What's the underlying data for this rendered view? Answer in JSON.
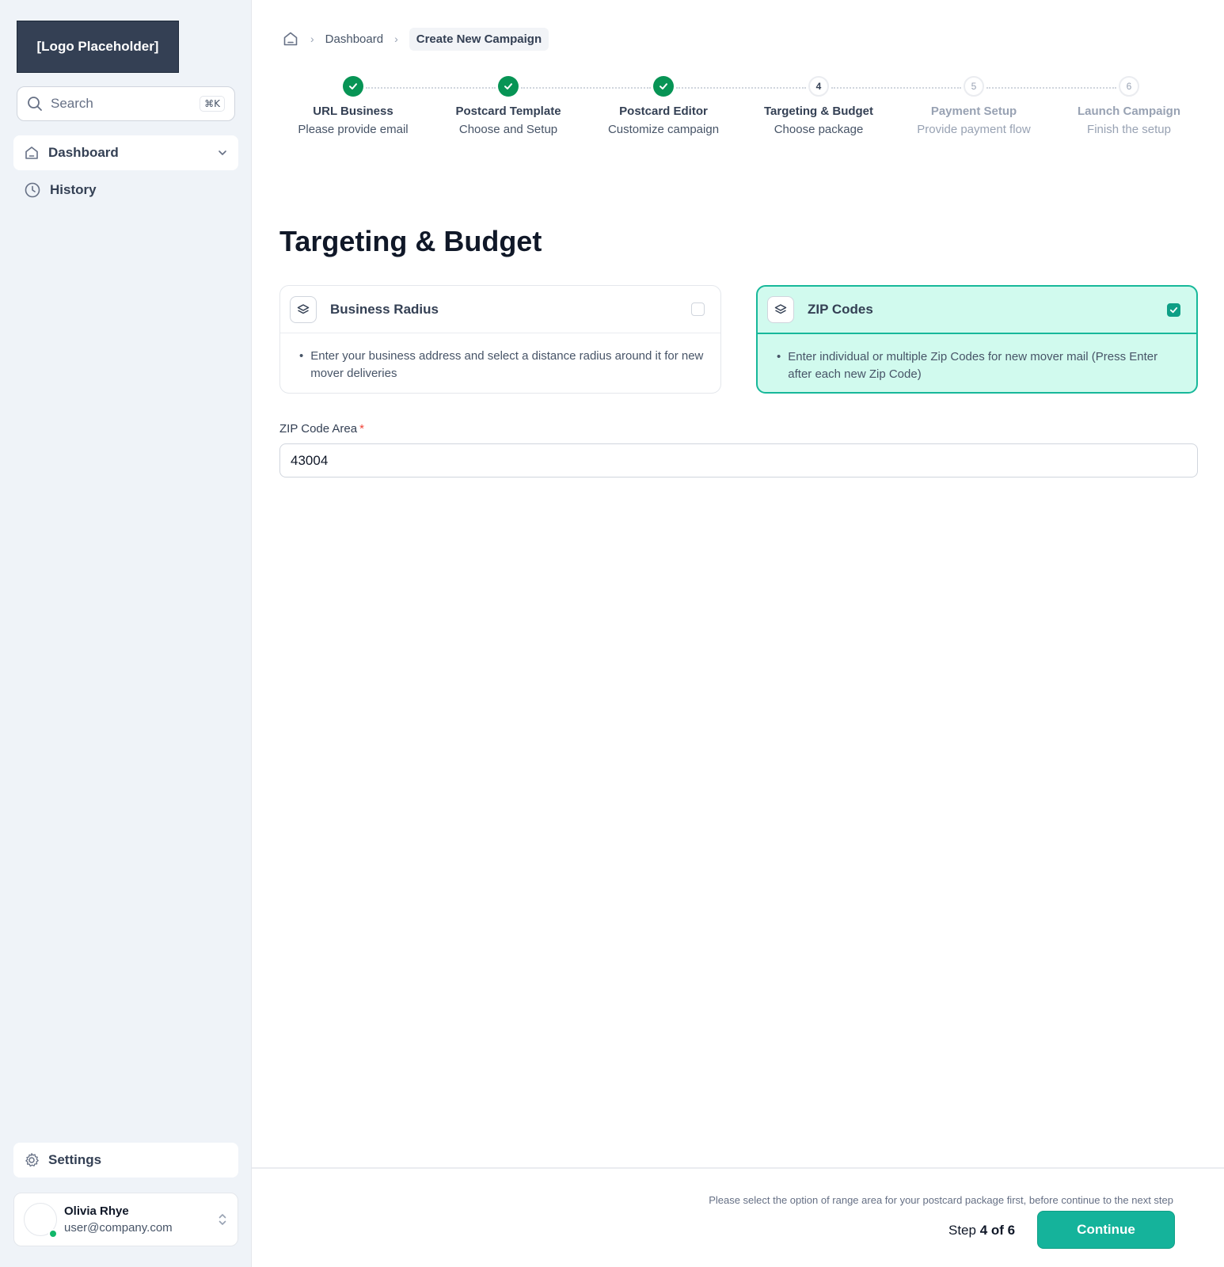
{
  "sidebar": {
    "logo_text": "[Logo Placeholder]",
    "search": {
      "placeholder": "Search",
      "shortcut": "⌘K"
    },
    "nav": [
      {
        "label": "Dashboard",
        "icon": "home-icon"
      },
      {
        "label": "History",
        "icon": "clock-icon"
      }
    ],
    "settings_label": "Settings",
    "user": {
      "name": "Olivia Rhye",
      "email": "user@company.com",
      "status_color": "#12b76a"
    }
  },
  "breadcrumb": {
    "home_icon": "home-icon",
    "items": [
      "Dashboard",
      "Create New Campaign"
    ]
  },
  "stepper": {
    "steps": [
      {
        "number": "1",
        "title": "URL Business",
        "subtitle": "Please provide email",
        "state": "done"
      },
      {
        "number": "2",
        "title": "Postcard Template",
        "subtitle": "Choose and Setup",
        "state": "done"
      },
      {
        "number": "3",
        "title": "Postcard Editor",
        "subtitle": "Customize campaign",
        "state": "done"
      },
      {
        "number": "4",
        "title": "Targeting & Budget",
        "subtitle": "Choose package",
        "state": "current"
      },
      {
        "number": "5",
        "title": "Payment Setup",
        "subtitle": "Provide payment flow",
        "state": "pending"
      },
      {
        "number": "6",
        "title": "Launch Campaign",
        "subtitle": "Finish the setup",
        "state": "pending"
      }
    ]
  },
  "main": {
    "title": "Targeting & Budget",
    "options": [
      {
        "title": "Business Radius",
        "description": "Enter your business address and select a distance radius around it for new mover deliveries",
        "selected": false,
        "icon": "layers-icon"
      },
      {
        "title": "ZIP Codes",
        "description": "Enter individual or multiple Zip Codes for new mover mail (Press Enter after each new Zip Code)",
        "selected": true,
        "icon": "layers-icon"
      }
    ],
    "zip_field": {
      "label": "ZIP Code Area",
      "required_mark": "*",
      "value": "43004"
    }
  },
  "footer": {
    "note": "Please select the option of range area for your postcard package first, before continue to the next step",
    "step_prefix": "Step ",
    "step_value": "4 of 6",
    "continue_label": "Continue"
  },
  "colors": {
    "accent": "#15b39b",
    "done": "#079455",
    "selected_bg": "#d1faee",
    "sidebar_bg": "#eff3f8"
  }
}
